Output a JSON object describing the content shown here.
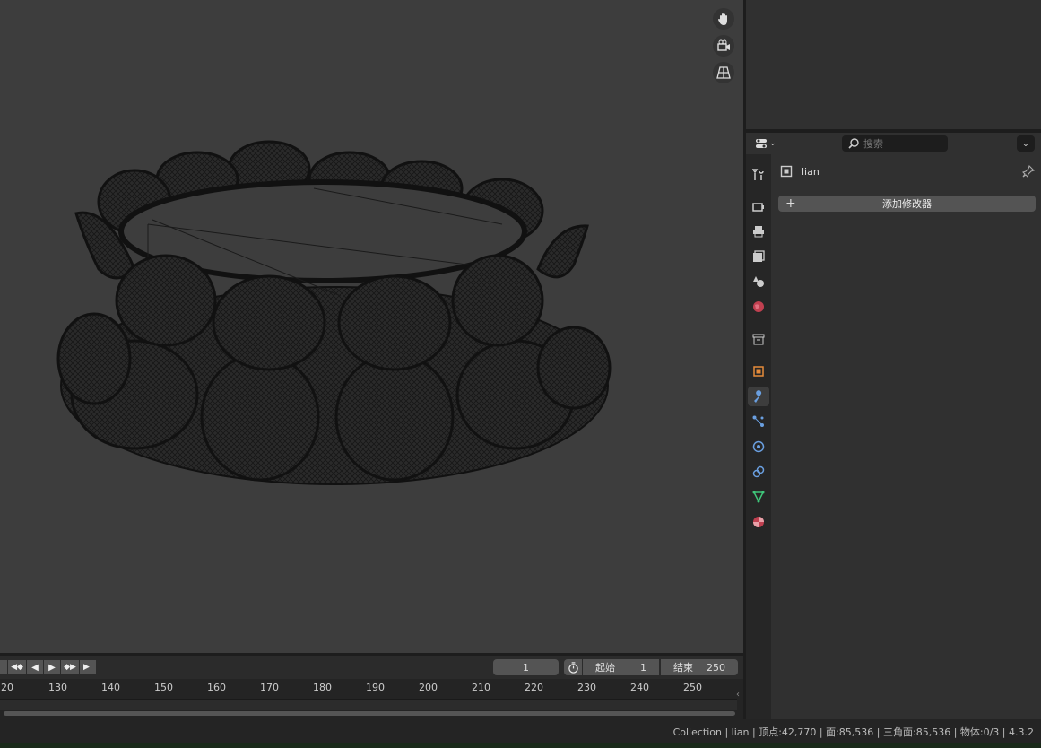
{
  "object": {
    "name": "lian"
  },
  "search": {
    "placeholder": "搜索"
  },
  "modifiers": {
    "add_label": "添加修改器"
  },
  "timeline": {
    "current_frame": "1",
    "start_label": "起始",
    "start_value": "1",
    "end_label": "结束",
    "end_value": "250",
    "ticks": [
      "20",
      "130",
      "140",
      "150",
      "160",
      "170",
      "180",
      "190",
      "200",
      "210",
      "220",
      "230",
      "240",
      "250"
    ]
  },
  "status": {
    "text": "Collection | lian | 顶点:42,770 | 面:85,536 | 三角面:85,536 | 物体:0/3 | 4.3.2"
  },
  "icons": {
    "viewport": [
      "hand-icon",
      "camera-icon",
      "grid-icon"
    ],
    "tabs": [
      "tool-icon",
      "render-icon",
      "output-icon",
      "view-layer-icon",
      "scene-icon",
      "world-icon",
      "collection-icon",
      "object-icon",
      "modifier-icon",
      "particles-icon",
      "physics-icon",
      "constraints-icon",
      "data-icon",
      "material-icon"
    ]
  },
  "colors": {
    "accent": "#4772b3",
    "viewport_bg": "#3d3d3d",
    "panel_bg": "#303030"
  }
}
